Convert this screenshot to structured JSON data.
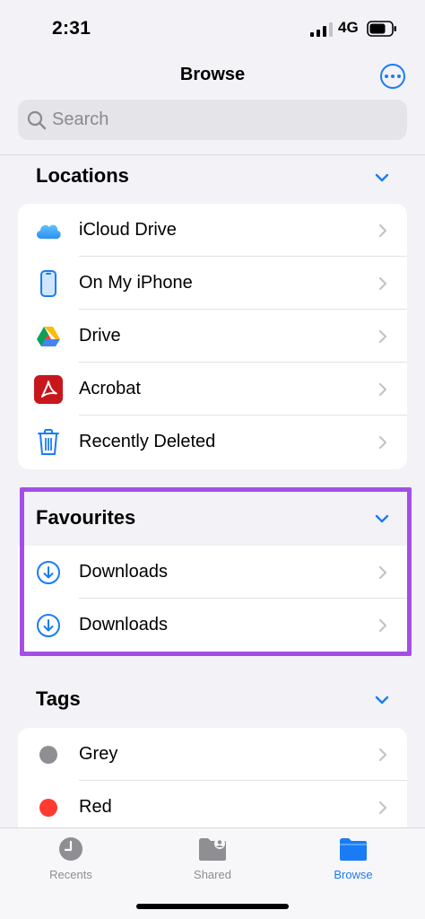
{
  "status": {
    "time": "2:31",
    "network": "4G"
  },
  "header": {
    "title": "Browse",
    "more_icon": "ellipsis-circle-icon"
  },
  "search": {
    "placeholder": "Search"
  },
  "locations": {
    "title": "Locations",
    "items": [
      {
        "label": "iCloud Drive",
        "icon": "icloud-icon"
      },
      {
        "label": "On My iPhone",
        "icon": "iphone-icon"
      },
      {
        "label": "Drive",
        "icon": "google-drive-icon"
      },
      {
        "label": "Acrobat",
        "icon": "acrobat-icon"
      },
      {
        "label": "Recently Deleted",
        "icon": "trash-icon"
      }
    ]
  },
  "favourites": {
    "title": "Favourites",
    "items": [
      {
        "label": "Downloads",
        "icon": "download-circle-icon"
      },
      {
        "label": "Downloads",
        "icon": "download-circle-icon"
      }
    ]
  },
  "tags": {
    "title": "Tags",
    "items": [
      {
        "label": "Grey",
        "color": "#8e8e93"
      },
      {
        "label": "Red",
        "color": "#ff3b30"
      }
    ]
  },
  "tabbar": {
    "tabs": [
      {
        "label": "Recents",
        "icon": "clock-icon",
        "active": false
      },
      {
        "label": "Shared",
        "icon": "shared-folder-icon",
        "active": false
      },
      {
        "label": "Browse",
        "icon": "folder-icon",
        "active": true
      }
    ]
  },
  "colors": {
    "accent": "#1a7cf5",
    "highlight": "#a54ee6"
  }
}
